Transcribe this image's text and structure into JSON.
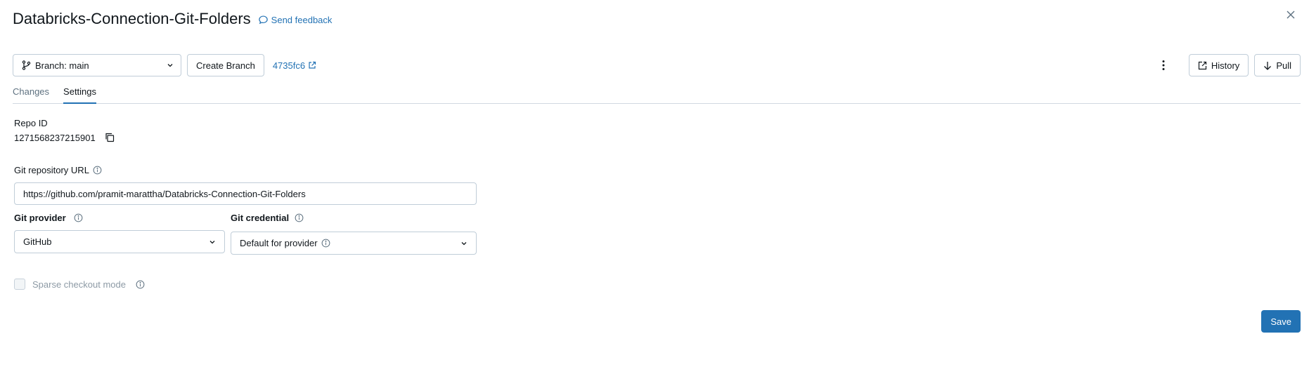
{
  "header": {
    "title": "Databricks-Connection-Git-Folders",
    "feedback_label": "Send feedback"
  },
  "toolbar": {
    "branch_label": "Branch: main",
    "create_branch_label": "Create Branch",
    "commit_hash": "4735fc6",
    "history_label": "History",
    "pull_label": "Pull"
  },
  "tabs": [
    {
      "label": "Changes",
      "active": false
    },
    {
      "label": "Settings",
      "active": true
    }
  ],
  "settings": {
    "repo_id_label": "Repo ID",
    "repo_id_value": "1271568237215901",
    "url_label": "Git repository URL",
    "url_value": "https://github.com/pramit-marattha/Databricks-Connection-Git-Folders",
    "provider_label": "Git provider",
    "provider_value": "GitHub",
    "credential_label": "Git credential",
    "credential_value": "Default for provider",
    "sparse_label": "Sparse checkout mode",
    "sparse_checked": false,
    "save_label": "Save"
  },
  "colors": {
    "accent": "#2272b4",
    "border": "#c0cdd8",
    "text": "#11171c",
    "muted": "#5f7281"
  },
  "icons": [
    "speech-bubble-icon",
    "close-icon",
    "git-branch-icon",
    "chevron-down-icon",
    "external-link-icon",
    "kebab-menu-icon",
    "history-icon",
    "arrow-down-icon",
    "info-icon",
    "copy-icon"
  ]
}
